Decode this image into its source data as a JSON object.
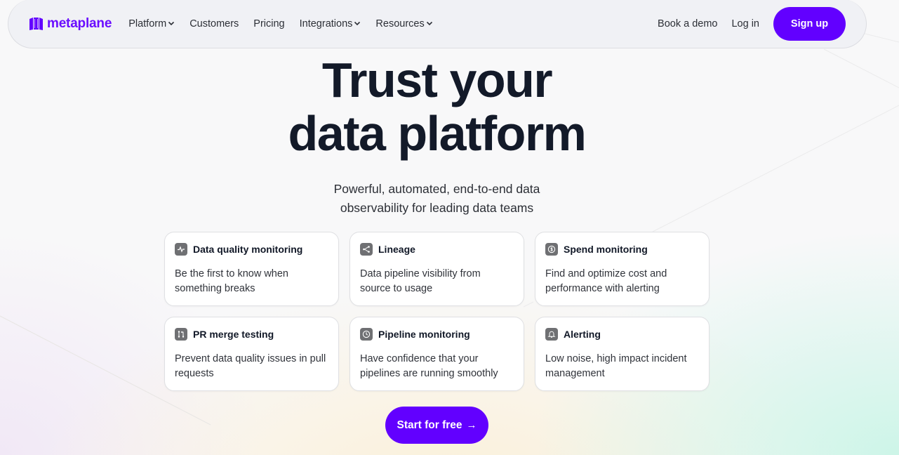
{
  "brand": {
    "name": "metaplane",
    "color": "#6200ff",
    "logo_icon": "building-columns-logo"
  },
  "nav": {
    "menu": [
      {
        "label": "Platform",
        "has_dropdown": true
      },
      {
        "label": "Customers",
        "has_dropdown": false
      },
      {
        "label": "Pricing",
        "has_dropdown": false
      },
      {
        "label": "Integrations",
        "has_dropdown": true
      },
      {
        "label": "Resources",
        "has_dropdown": true
      }
    ],
    "book_demo": "Book a demo",
    "login": "Log in",
    "signup": "Sign up"
  },
  "hero": {
    "title_line1": "Trust your",
    "title_line2": "data platform",
    "subtitle_line1": "Powerful, automated, end-to-end data",
    "subtitle_line2": "observability for leading data teams"
  },
  "features": [
    {
      "icon": "pulse-icon",
      "title": "Data quality monitoring",
      "description": "Be the first to know when something breaks"
    },
    {
      "icon": "lineage-icon",
      "title": "Lineage",
      "description": "Data pipeline visibility from source to usage"
    },
    {
      "icon": "dollar-coin-icon",
      "title": "Spend monitoring",
      "description": "Find and optimize cost and performance with alerting"
    },
    {
      "icon": "pull-request-icon",
      "title": "PR merge testing",
      "description": "Prevent data quality issues in pull requests"
    },
    {
      "icon": "clock-icon",
      "title": "Pipeline monitoring",
      "description": "Have confidence that your pipelines are running smoothly"
    },
    {
      "icon": "bell-icon",
      "title": "Alerting",
      "description": "Low noise, high impact incident management"
    }
  ],
  "cta": {
    "label": "Start for free",
    "arrow": "→"
  }
}
